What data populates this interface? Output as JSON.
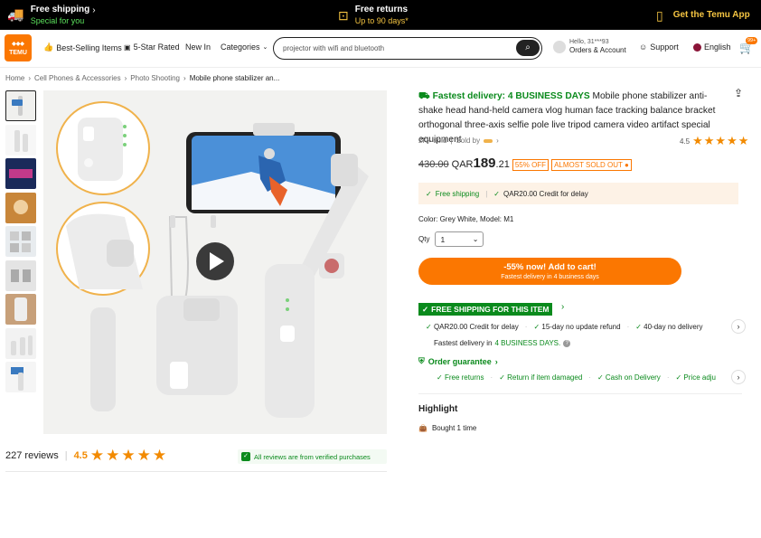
{
  "topbar": {
    "free_shipping": "Free shipping",
    "free_shipping_sub": "Special for you",
    "free_returns": "Free returns",
    "free_returns_sub": "Up to 90 days*",
    "app": "Get the Temu App"
  },
  "header": {
    "logo": "TEMU",
    "nav": [
      "Best-Selling Items",
      "5-Star Rated",
      "New In",
      "Categories"
    ],
    "search_value": "projector with wifi and bluetooth",
    "account_hello": "Hello, 31***93",
    "account_label": "Orders & Account",
    "support": "Support",
    "language": "English",
    "cart_badge": "99+"
  },
  "breadcrumb": [
    "Home",
    "Cell Phones & Accessories",
    "Photo Shooting",
    "Mobile phone stabilizer an..."
  ],
  "reviews": {
    "count_label": "227 reviews",
    "rating": "4.5",
    "stars": "★★★★★",
    "verified": "All reviews are from verified purchases"
  },
  "product": {
    "fastest": "Fastest delivery: 4 BUSINESS DAYS",
    "title": "Mobile phone stabilizer anti-shake head hand-held camera vlog human face tracking balance bracket orthogonal three-axis selfie pole live tripod camera video artifact special equipment",
    "sold": "2K+ sold",
    "sold_by": "Sold by",
    "rating": "4.5",
    "stars": "★★★★★",
    "old_price": "430.00",
    "currency": "QAR",
    "price_int": "189",
    "price_dec": ".21",
    "discount": "55% OFF",
    "almost": "ALMOST SOLD OUT",
    "box_free": "Free shipping",
    "box_credit": "QAR20.00 Credit for delay",
    "variant": "Color: Grey White, Model: M1",
    "qty_label": "Qty",
    "qty_value": "1",
    "cart_main": "-55% now! Add to cart!",
    "cart_sub": "Fastest delivery in 4 business days",
    "fs_item": "FREE SHIPPING FOR THIS ITEM",
    "perks": [
      "QAR20.00 Credit for delay",
      "15-day no update refund",
      "40-day no delivery"
    ],
    "fastest_line": "Fastest delivery in",
    "fastest_days": "4 BUSINESS DAYS.",
    "order_guarantee": "Order guarantee",
    "guarantees": [
      "Free returns",
      "Return if item damaged",
      "Cash on Delivery",
      "Price adju"
    ],
    "highlight": "Highlight",
    "bought": "Bought 1 time"
  },
  "colors": {
    "accent": "#fb7701",
    "green": "#0a8a1c",
    "topbar": "#000000",
    "star": "#f28a00"
  }
}
